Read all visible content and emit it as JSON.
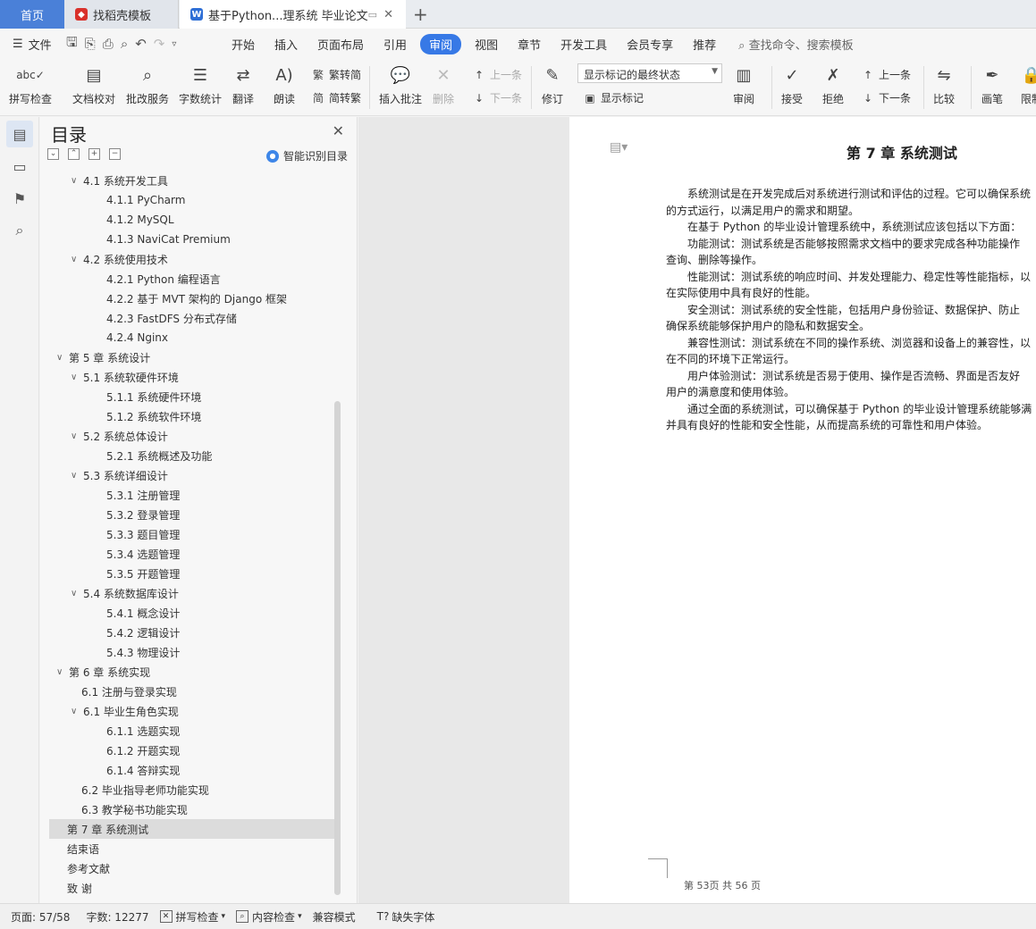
{
  "tabs": {
    "home": "首页",
    "templates": "找稻壳模板",
    "document": "基于Python...理系统 毕业论文"
  },
  "menubar": {
    "file": "文件",
    "items": [
      "开始",
      "插入",
      "页面布局",
      "引用",
      "审阅",
      "视图",
      "章节",
      "开发工具",
      "会员专享",
      "推荐"
    ],
    "active_index": 4,
    "search": "查找命令、搜索模板"
  },
  "ribbon": {
    "spell_check": "拼写检查",
    "doc_proof": "文档校对",
    "review_service": "批改服务",
    "word_count": "字数统计",
    "translate": "翻译",
    "read_aloud": "朗读",
    "trad_simp": "繁转简",
    "simp_trad": "简转繁",
    "insert_comment": "插入批注",
    "delete": "删除",
    "prev_comment": "上一条",
    "next_comment": "下一条",
    "track_changes": "修订",
    "markup_select": "显示标记的最终状态",
    "show_markup": "显示标记",
    "review_pane": "审阅",
    "accept": "接受",
    "reject": "拒绝",
    "prev_change": "上一条",
    "next_change": "下一条",
    "compare": "比较",
    "pen": "画笔",
    "restrict": "限制"
  },
  "toc": {
    "title": "目录",
    "ai_button": "智能识别目录",
    "items": [
      {
        "label": "4.1  系统开发工具",
        "level": 2,
        "chev": true
      },
      {
        "label": "4.1.1 PyCharm",
        "level": 3
      },
      {
        "label": "4.1.2 MySQL",
        "level": 3
      },
      {
        "label": "4.1.3 NaviCat Premium",
        "level": 3
      },
      {
        "label": "4.2  系统使用技术",
        "level": 2,
        "chev": true
      },
      {
        "label": "4.2.1 Python 编程语言",
        "level": 3
      },
      {
        "label": "4.2.2 基于 MVT 架构的 Django 框架",
        "level": 3
      },
      {
        "label": "4.2.3 FastDFS 分布式存储",
        "level": 3
      },
      {
        "label": "4.2.4 Nginx",
        "level": 3
      },
      {
        "label": "第 5 章  系统设计",
        "level": 1,
        "chev": true
      },
      {
        "label": "5.1 系统软硬件环境",
        "level": 2,
        "chev": true
      },
      {
        "label": "5.1.1  系统硬件环境",
        "level": 3
      },
      {
        "label": "5.1.2  系统软件环境",
        "level": 3
      },
      {
        "label": "5.2 系统总体设计",
        "level": 2,
        "chev": true
      },
      {
        "label": "5.2.1 系统概述及功能",
        "level": 3
      },
      {
        "label": "5.3 系统详细设计",
        "level": 2,
        "chev": true
      },
      {
        "label": "5.3.1  注册管理",
        "level": 3
      },
      {
        "label": "5.3.2  登录管理",
        "level": 3
      },
      {
        "label": "5.3.3  题目管理",
        "level": 3
      },
      {
        "label": "5.3.4  选题管理",
        "level": 3
      },
      {
        "label": "5.3.5  开题管理",
        "level": 3
      },
      {
        "label": "5.4 系统数据库设计",
        "level": 2,
        "chev": true
      },
      {
        "label": "5.4.1  概念设计",
        "level": 3
      },
      {
        "label": "5.4.2  逻辑设计",
        "level": 3
      },
      {
        "label": "5.4.3  物理设计",
        "level": 3
      },
      {
        "label": "第 6 章  系统实现",
        "level": 1,
        "chev": true
      },
      {
        "label": "6.1  注册与登录实现",
        "level": 2
      },
      {
        "label": "6.1 毕业生角色实现",
        "level": 2,
        "chev": true
      },
      {
        "label": "6.1.1 选题实现",
        "level": 3
      },
      {
        "label": "6.1.2  开题实现",
        "level": 3
      },
      {
        "label": "6.1.4  答辩实现",
        "level": 3
      },
      {
        "label": "6.2  毕业指导老师功能实现",
        "level": 2
      },
      {
        "label": "6.3  教学秘书功能实现",
        "level": 2
      },
      {
        "label": "第 7 章  系统测试",
        "level": 1,
        "selected": true
      },
      {
        "label": "结束语",
        "level": 1
      },
      {
        "label": "参考文献",
        "level": 1
      },
      {
        "label": "致  谢",
        "level": 1
      }
    ]
  },
  "document": {
    "chapter_title": "第 7 章  系统测试",
    "paragraphs": [
      "系统测试是在开发完成后对系统进行测试和评估的过程。它可以确保系统",
      "的方式运行，以满足用户的需求和期望。",
      "在基于 Python 的毕业设计管理系统中，系统测试应该包括以下方面：",
      "功能测试：测试系统是否能够按照需求文档中的要求完成各种功能操作",
      "查询、删除等操作。",
      "性能测试：测试系统的响应时间、并发处理能力、稳定性等性能指标，以",
      "在实际使用中具有良好的性能。",
      "安全测试：测试系统的安全性能，包括用户身份验证、数据保护、防止",
      "确保系统能够保护用户的隐私和数据安全。",
      "兼容性测试：测试系统在不同的操作系统、浏览器和设备上的兼容性，以",
      "在不同的环境下正常运行。",
      "用户体验测试：测试系统是否易于使用、操作是否流畅、界面是否友好",
      "用户的满意度和使用体验。",
      "通过全面的系统测试，可以确保基于 Python 的毕业设计管理系统能够满",
      "并具有良好的性能和安全性能，从而提高系统的可靠性和用户体验。"
    ],
    "indented": [
      0,
      2,
      3,
      5,
      7,
      9,
      11,
      13
    ],
    "page_footer": "第 53页  共 56  页"
  },
  "statusbar": {
    "page": "页面: 57/58",
    "words": "字数: 12277",
    "spell": "拼写检查",
    "content": "内容检查",
    "compat": "兼容模式",
    "missing_font": "缺失字体"
  },
  "colors": {
    "accent": "#3779e6",
    "home_tab": "#4a80d8"
  }
}
